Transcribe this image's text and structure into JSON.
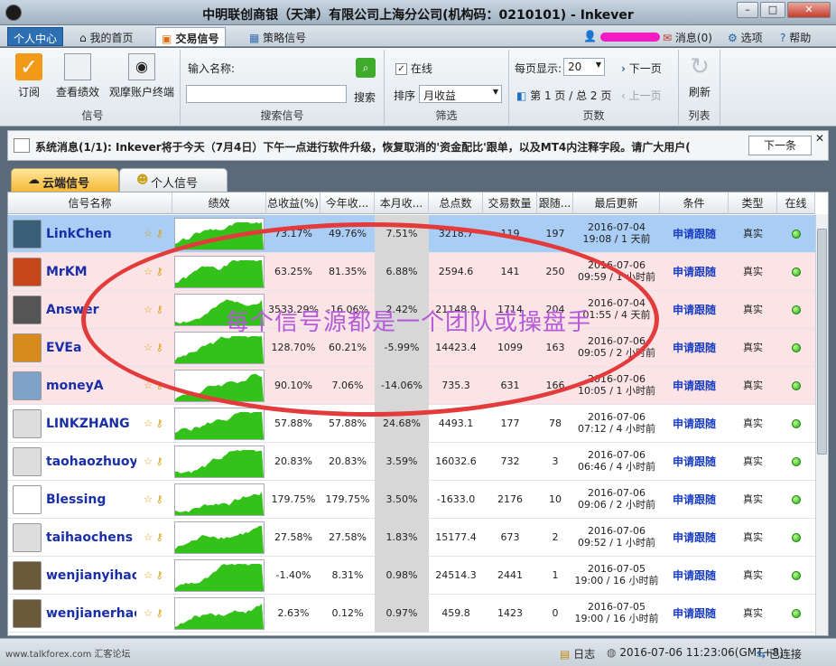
{
  "window": {
    "title": "中明联创商银（天津）有限公司上海分公司(机构码：0210101) - Inkever"
  },
  "menu": {
    "personal_center": "个人中心",
    "home": "我的首页",
    "trade_signal": "交易信号",
    "strategy_signal": "策略信号",
    "message": "消息(0)",
    "options": "选项",
    "help": "帮助"
  },
  "ribbon": {
    "subscribe": "订阅",
    "view_perf": "查看绩效",
    "watch_terminal": "观摩账户终端",
    "group_signal": "信号",
    "search_name_label": "输入名称:",
    "search_btn": "搜索",
    "group_search": "搜索信号",
    "online_label": "在线",
    "sort_label": "排序",
    "sort_value": "月收益",
    "group_filter": "筛选",
    "per_page_label": "每页显示:",
    "per_page_value": "20",
    "page_info": "第 1 页 / 总 2 页",
    "next_page": "下一页",
    "prev_page": "上一页",
    "group_pages": "页数",
    "refresh": "刷新",
    "group_list": "列表"
  },
  "sysmsg": {
    "text": "系统消息(1/1):  Inkever将于今天（7月4日）下午一点进行软件升级，恢复取消的'资金配比'跟单，以及MT4内注释字段。请广大用户(",
    "next": "下一条"
  },
  "tabs": {
    "cloud": "云端信号",
    "personal": "个人信号"
  },
  "table": {
    "headers": [
      "信号名称",
      "绩效",
      "总收益(%)",
      "今年收...",
      "本月收...",
      "总点数",
      "交易数量",
      "跟随...",
      "最后更新",
      "条件",
      "类型",
      "在线"
    ],
    "rows": [
      {
        "name": "LinkChen",
        "total": "73.17%",
        "year": "49.76%",
        "month": "7.51%",
        "points": "3218.7",
        "trades": "119",
        "follow": "197",
        "date": "2016-07-04",
        "ago": "19:08 / 1 天前",
        "apply": "申请跟随",
        "type": "真实",
        "selected": true,
        "pink": false,
        "av": "#3a5f7a"
      },
      {
        "name": "MrKM",
        "total": "63.25%",
        "year": "81.35%",
        "month": "6.88%",
        "points": "2594.6",
        "trades": "141",
        "follow": "250",
        "date": "2016-07-06",
        "ago": "09:59 / 1 小时前",
        "apply": "申请跟随",
        "type": "真实",
        "selected": false,
        "pink": true,
        "av": "#c9461b"
      },
      {
        "name": "Answer",
        "total": "3533.29%",
        "year": "-16.06%",
        "month": "2.42%",
        "points": "21148.9",
        "trades": "1714",
        "follow": "204",
        "date": "2016-07-04",
        "ago": "01:55 / 4 天前",
        "apply": "申请跟随",
        "type": "真实",
        "selected": false,
        "pink": true,
        "av": "#555555"
      },
      {
        "name": "EVEa",
        "total": "128.70%",
        "year": "60.21%",
        "month": "-5.99%",
        "points": "14423.4",
        "trades": "1099",
        "follow": "163",
        "date": "2016-07-06",
        "ago": "09:05 / 2 小时前",
        "apply": "申请跟随",
        "type": "真实",
        "selected": false,
        "pink": true,
        "av": "#d98a1c"
      },
      {
        "name": "moneyA",
        "total": "90.10%",
        "year": "7.06%",
        "month": "-14.06%",
        "points": "735.3",
        "trades": "631",
        "follow": "166",
        "date": "2016-07-06",
        "ago": "10:05 / 1 小时前",
        "apply": "申请跟随",
        "type": "真实",
        "selected": false,
        "pink": true,
        "av": "#7fa2c8"
      },
      {
        "name": "LINKZHANG",
        "total": "57.88%",
        "year": "57.88%",
        "month": "24.68%",
        "points": "4493.1",
        "trades": "177",
        "follow": "78",
        "date": "2016-07-06",
        "ago": "07:12 / 4 小时前",
        "apply": "申请跟随",
        "type": "真实",
        "selected": false,
        "pink": false,
        "av": "#dddddd"
      },
      {
        "name": "taohaozhuoy",
        "total": "20.83%",
        "year": "20.83%",
        "month": "3.59%",
        "points": "16032.6",
        "trades": "732",
        "follow": "3",
        "date": "2016-07-06",
        "ago": "06:46 / 4 小时前",
        "apply": "申请跟随",
        "type": "真实",
        "selected": false,
        "pink": false,
        "av": "#dddddd"
      },
      {
        "name": "Blessing",
        "total": "179.75%",
        "year": "179.75%",
        "month": "3.50%",
        "points": "-1633.0",
        "trades": "2176",
        "follow": "10",
        "date": "2016-07-06",
        "ago": "09:06 / 2 小时前",
        "apply": "申请跟随",
        "type": "真实",
        "selected": false,
        "pink": false,
        "av": "#ffffff"
      },
      {
        "name": "taihaochens",
        "total": "27.58%",
        "year": "27.58%",
        "month": "1.83%",
        "points": "15177.4",
        "trades": "673",
        "follow": "2",
        "date": "2016-07-06",
        "ago": "09:52 / 1 小时前",
        "apply": "申请跟随",
        "type": "真实",
        "selected": false,
        "pink": false,
        "av": "#dddddd"
      },
      {
        "name": "wenjianyihao",
        "total": "-1.40%",
        "year": "8.31%",
        "month": "0.98%",
        "points": "24514.3",
        "trades": "2441",
        "follow": "1",
        "date": "2016-07-05",
        "ago": "19:00 / 16 小时前",
        "apply": "申请跟随",
        "type": "真实",
        "selected": false,
        "pink": false,
        "av": "#6b5a3a"
      },
      {
        "name": "wenjianerhao",
        "total": "2.63%",
        "year": "0.12%",
        "month": "0.97%",
        "points": "459.8",
        "trades": "1423",
        "follow": "0",
        "date": "2016-07-05",
        "ago": "19:00 / 16 小时前",
        "apply": "申请跟随",
        "type": "真实",
        "selected": false,
        "pink": false,
        "av": "#6b5a3a"
      }
    ]
  },
  "status": {
    "log": "日志",
    "datetime": "2016-07-06 11:23:06(GMT+8)",
    "connected": "已连接",
    "watermark": "www.talkforex.com 汇客论坛"
  },
  "annotation": {
    "text": "每个信号源都是一个团队或操盘手"
  },
  "colors": {
    "selected_row": "#a9cdf4",
    "pink_row": "#fce4e6",
    "month_col": "#d7d7d7",
    "link_blue": "#1a2ea8",
    "annotation_red": "#e33b3b"
  }
}
